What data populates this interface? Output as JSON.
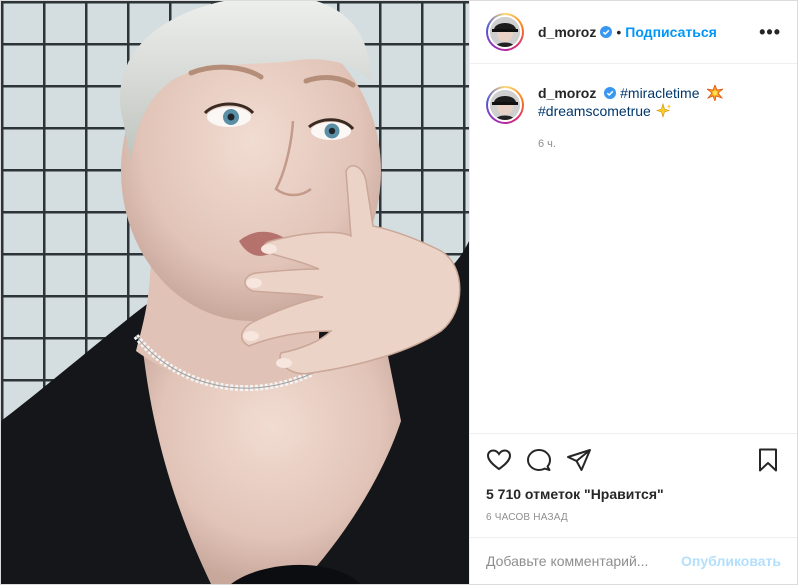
{
  "photo": {
    "icon": "portrait-photo"
  },
  "header": {
    "username": "d_moroz",
    "separator": "•",
    "follow_label": "Подписаться",
    "more_label": "•••"
  },
  "caption": {
    "username": "d_moroz",
    "hashtag1": "#miracletime",
    "hashtag2": "#dreamscometrue",
    "time_ago": "6 ч."
  },
  "actions": {
    "icons": [
      "heart-icon",
      "comment-icon",
      "share-icon",
      "bookmark-icon"
    ],
    "likes": "5 710 отметок \"Нравится\"",
    "timestamp": "6 ЧАСОВ НАЗАД"
  },
  "comment": {
    "placeholder": "Добавьте комментарий...",
    "publish_label": "Опубликовать"
  },
  "colors": {
    "link_blue": "#0095f6",
    "hashtag_blue": "#00376b",
    "publish_disabled": "#b2dffc",
    "muted": "#8e8e8e"
  }
}
